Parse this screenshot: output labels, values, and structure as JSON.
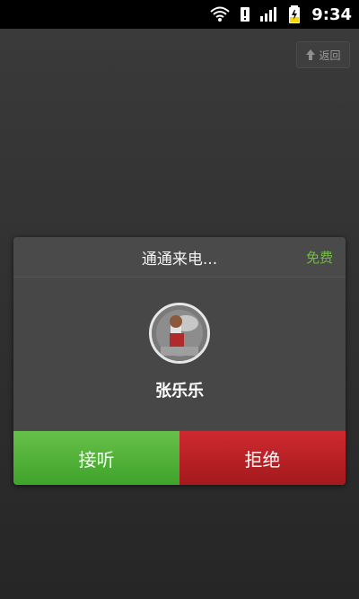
{
  "status_bar": {
    "time": "9:34",
    "icons": [
      "wifi-icon",
      "sim-alert-icon",
      "signal-icon",
      "battery-icon"
    ]
  },
  "top_right": {
    "back_label": "返回",
    "back_icon": "up-arrow-icon"
  },
  "call_dialog": {
    "title": "通通来电...",
    "badge": "免费",
    "caller_name": "张乐乐",
    "avatar_icon": "avatar",
    "answer_label": "接听",
    "decline_label": "拒绝",
    "colors": {
      "accent_green": "#6fbf3b",
      "answer_green": "#4fb333",
      "decline_red": "#c52227",
      "dialog_bg": "#4b4b4b"
    }
  }
}
